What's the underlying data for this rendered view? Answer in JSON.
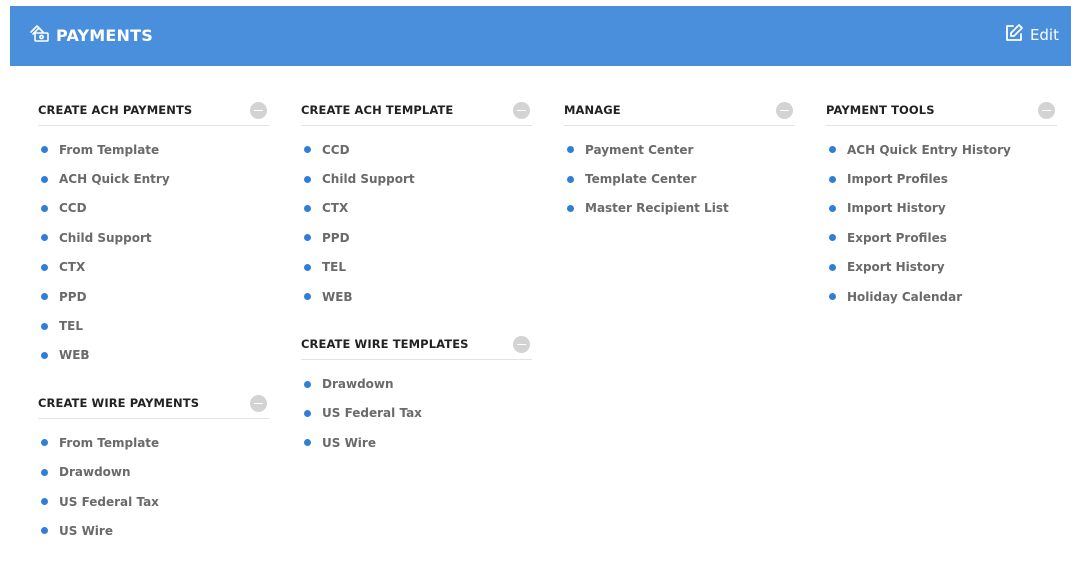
{
  "header": {
    "title": "PAYMENTS",
    "icon": "payments-icon",
    "edit_label": "Edit",
    "edit_icon": "edit-icon",
    "background": "#4a8fdb"
  },
  "columns": [
    {
      "sections": [
        {
          "title": "CREATE ACH PAYMENTS",
          "items": [
            "From Template",
            "ACH Quick Entry",
            "CCD",
            "Child Support",
            "CTX",
            "PPD",
            "TEL",
            "WEB"
          ]
        },
        {
          "title": "CREATE WIRE PAYMENTS",
          "items": [
            "From Template",
            "Drawdown",
            "US Federal Tax",
            "US Wire"
          ]
        }
      ]
    },
    {
      "sections": [
        {
          "title": "CREATE ACH TEMPLATE",
          "items": [
            "CCD",
            "Child Support",
            "CTX",
            "PPD",
            "TEL",
            "WEB"
          ]
        },
        {
          "title": "CREATE WIRE TEMPLATES",
          "items": [
            "Drawdown",
            "US Federal Tax",
            "US Wire"
          ]
        }
      ]
    },
    {
      "sections": [
        {
          "title": "MANAGE",
          "items": [
            "Payment Center",
            "Template Center",
            "Master Recipient List"
          ]
        }
      ]
    },
    {
      "sections": [
        {
          "title": "PAYMENT TOOLS",
          "items": [
            "ACH Quick Entry History",
            "Import Profiles",
            "Import History",
            "Export Profiles",
            "Export History",
            "Holiday Calendar"
          ]
        }
      ]
    }
  ],
  "colors": {
    "accent": "#2f7fd6",
    "item_text": "#6a6a6a",
    "collapse_button": "#d3d3d3"
  }
}
